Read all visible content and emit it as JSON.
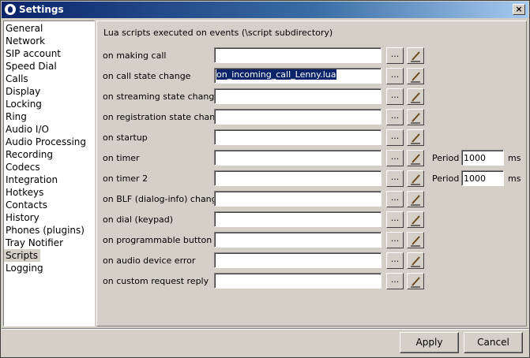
{
  "window": {
    "title": "Settings",
    "close_label": "×"
  },
  "sidebar": {
    "items": [
      {
        "label": "General"
      },
      {
        "label": "Network"
      },
      {
        "label": "SIP account"
      },
      {
        "label": "Speed Dial"
      },
      {
        "label": "Calls"
      },
      {
        "label": "Display"
      },
      {
        "label": "Locking"
      },
      {
        "label": "Ring"
      },
      {
        "label": "Audio I/O"
      },
      {
        "label": "Audio Processing"
      },
      {
        "label": "Recording"
      },
      {
        "label": "Codecs"
      },
      {
        "label": "Integration"
      },
      {
        "label": "Hotkeys"
      },
      {
        "label": "Contacts"
      },
      {
        "label": "History"
      },
      {
        "label": "Phones (plugins)"
      },
      {
        "label": "Tray Notifier"
      },
      {
        "label": "Scripts"
      },
      {
        "label": "Logging"
      }
    ],
    "selected": "Scripts"
  },
  "scripts": {
    "heading": "Lua scripts executed on events (\\script subdirectory)",
    "browse_label": "...",
    "rows": [
      {
        "label": "on making call",
        "value": ""
      },
      {
        "label": "on call state change",
        "value": "on_incoming_call_Lenny.lua"
      },
      {
        "label": "on streaming state change",
        "value": ""
      },
      {
        "label": "on registration state change",
        "value": ""
      },
      {
        "label": "on startup",
        "value": ""
      },
      {
        "label": "on timer",
        "value": "",
        "period_label": "Period",
        "period_value": "1000",
        "unit": "ms"
      },
      {
        "label": "on timer 2",
        "value": "",
        "period_label": "Period",
        "period_value": "1000",
        "unit": "ms"
      },
      {
        "label": "on BLF (dialog-info) change",
        "value": ""
      },
      {
        "label": "on dial (keypad)",
        "value": ""
      },
      {
        "label": "on programmable button",
        "value": ""
      },
      {
        "label": "on audio device error",
        "value": ""
      },
      {
        "label": "on custom request reply",
        "value": ""
      }
    ]
  },
  "footer": {
    "apply_label": "Apply",
    "cancel_label": "Cancel"
  }
}
